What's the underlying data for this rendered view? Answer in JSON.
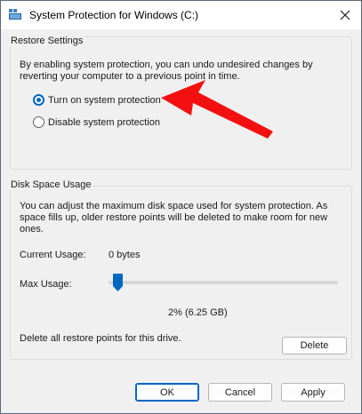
{
  "window": {
    "title": "System Protection for Windows (C:)",
    "accent_color": "#0067c0"
  },
  "restore_settings": {
    "group_label": "Restore Settings",
    "description_line1": "By enabling system protection, you can undo undesired changes by",
    "description_line2": "reverting your computer to a previous point in time.",
    "options": [
      {
        "label": "Turn on system protection",
        "selected": true
      },
      {
        "label": "Disable system protection",
        "selected": false
      }
    ]
  },
  "disk_space_usage": {
    "group_label": "Disk Space Usage",
    "description_line1": "You can adjust the maximum disk space used for system protection. As",
    "description_line2": "space fills up, older restore points will be deleted to make room for new",
    "description_line3": "ones.",
    "current_usage_label": "Current Usage:",
    "current_usage_value": "0 bytes",
    "max_usage_label": "Max Usage:",
    "max_usage_percent": 2,
    "max_usage_readout": "2% (6.25 GB)",
    "delete_text": "Delete all restore points for this drive.",
    "delete_button": "Delete"
  },
  "footer": {
    "ok": "OK",
    "cancel": "Cancel",
    "apply": "Apply"
  },
  "annotation": {
    "arrow_color": "#ff0000",
    "arrow_icon": "red-pointer-arrow-icon"
  }
}
